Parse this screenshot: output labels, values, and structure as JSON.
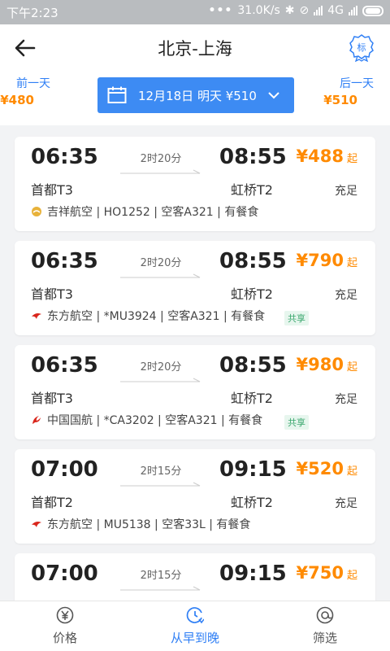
{
  "status_bar": {
    "time": "下午2:23",
    "net_speed": "31.0K/s",
    "network": "4G"
  },
  "header": {
    "title": "北京-上海",
    "prev_day": {
      "label": "前一天",
      "price": "¥480"
    },
    "next_day": {
      "label": "后一天",
      "price": "¥510"
    },
    "date_selector": "12月18日 明天 ¥510",
    "badge_char": "标"
  },
  "flights": [
    {
      "dep_time": "06:35",
      "duration": "2时20分",
      "arr_time": "08:55",
      "price": "¥488",
      "price_suffix": "起",
      "dep_airport": "首都T3",
      "arr_airport": "虹桥T2",
      "seats": "充足",
      "airline_info": "吉祥航空 | HO1252 | 空客A321 | 有餐食",
      "logo": "juneyao-logo-icon",
      "share": ""
    },
    {
      "dep_time": "06:35",
      "duration": "2时20分",
      "arr_time": "08:55",
      "price": "¥790",
      "price_suffix": "起",
      "dep_airport": "首都T3",
      "arr_airport": "虹桥T2",
      "seats": "充足",
      "airline_info": "东方航空 | *MU3924 | 空客A321 | 有餐食",
      "logo": "china-eastern-logo-icon",
      "share": "共享"
    },
    {
      "dep_time": "06:35",
      "duration": "2时20分",
      "arr_time": "08:55",
      "price": "¥980",
      "price_suffix": "起",
      "dep_airport": "首都T3",
      "arr_airport": "虹桥T2",
      "seats": "充足",
      "airline_info": "中国国航 | *CA3202 | 空客A321 | 有餐食",
      "logo": "air-china-logo-icon",
      "share": "共享"
    },
    {
      "dep_time": "07:00",
      "duration": "2时15分",
      "arr_time": "09:15",
      "price": "¥520",
      "price_suffix": "起",
      "dep_airport": "首都T2",
      "arr_airport": "虹桥T2",
      "seats": "充足",
      "airline_info": "东方航空 | MU5138 | 空客33L | 有餐食",
      "logo": "china-eastern-logo-icon",
      "share": ""
    },
    {
      "dep_time": "07:00",
      "duration": "2时15分",
      "arr_time": "09:15",
      "price": "¥750",
      "price_suffix": "起",
      "dep_airport": "",
      "arr_airport": "",
      "seats": "",
      "airline_info": "",
      "logo": "",
      "share": ""
    }
  ],
  "tabs": [
    {
      "label": "价格",
      "icon": "yuan-icon"
    },
    {
      "label": "从早到晚",
      "icon": "clock-sort-icon",
      "active": true
    },
    {
      "label": "筛选",
      "icon": "filter-icon"
    }
  ],
  "colors": {
    "accent": "#2f7ff5",
    "price": "#ff8a00",
    "share": "#3aa76d"
  }
}
